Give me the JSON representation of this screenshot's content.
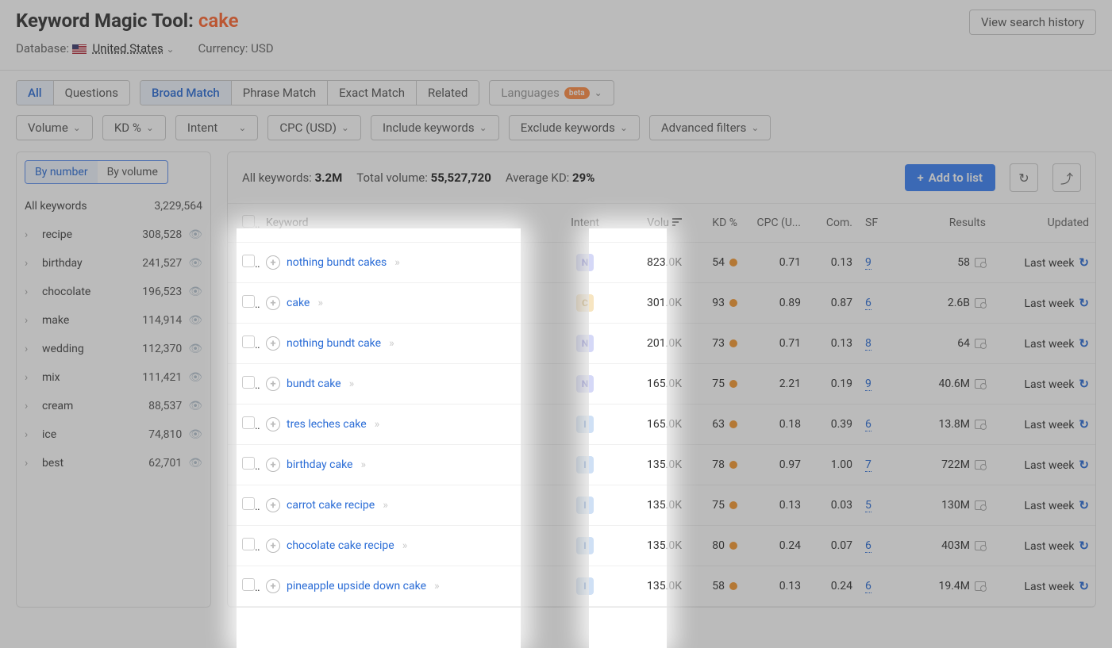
{
  "header": {
    "title_prefix": "Keyword Magic Tool:",
    "title_keyword": "cake",
    "database_label": "Database:",
    "database_value": "United States",
    "currency_label": "Currency:",
    "currency_value": "USD",
    "history_btn": "View search history"
  },
  "tabs_left": {
    "all": "All",
    "questions": "Questions"
  },
  "tabs_match": {
    "broad": "Broad Match",
    "phrase": "Phrase Match",
    "exact": "Exact Match",
    "related": "Related"
  },
  "languages_btn": "Languages",
  "beta_badge": "beta",
  "filters": {
    "volume": "Volume",
    "kd": "KD %",
    "intent": "Intent",
    "cpc": "CPC (USD)",
    "include": "Include keywords",
    "exclude": "Exclude keywords",
    "advanced": "Advanced filters"
  },
  "sidebar": {
    "seg_number": "By number",
    "seg_volume": "By volume",
    "all_label": "All keywords",
    "all_count": "3,229,564",
    "groups": [
      {
        "label": "recipe",
        "count": "308,528"
      },
      {
        "label": "birthday",
        "count": "241,527"
      },
      {
        "label": "chocolate",
        "count": "196,523"
      },
      {
        "label": "make",
        "count": "114,914"
      },
      {
        "label": "wedding",
        "count": "112,370"
      },
      {
        "label": "mix",
        "count": "111,421"
      },
      {
        "label": "cream",
        "count": "88,537"
      },
      {
        "label": "ice",
        "count": "74,810"
      },
      {
        "label": "best",
        "count": "62,701"
      }
    ]
  },
  "stats": {
    "all_kw_label": "All keywords:",
    "all_kw_value": "3.2M",
    "total_vol_label": "Total volume:",
    "total_vol_value": "55,527,720",
    "avg_kd_label": "Average KD:",
    "avg_kd_value": "29%",
    "add_to_list": "Add to list"
  },
  "columns": {
    "keyword": "Keyword",
    "intent": "Intent",
    "volume": "Volu",
    "kd": "KD %",
    "cpc": "CPC (U...",
    "com": "Com.",
    "sf": "SF",
    "results": "Results",
    "updated": "Updated"
  },
  "rows": [
    {
      "kw": "nothing bundt cakes",
      "intent": "N",
      "vol": "823.0K",
      "kd": "54",
      "cpc": "0.71",
      "com": "0.13",
      "sf": "9",
      "results": "58",
      "updated": "Last week"
    },
    {
      "kw": "cake",
      "intent": "C",
      "vol": "301.0K",
      "kd": "93",
      "cpc": "0.89",
      "com": "0.87",
      "sf": "6",
      "results": "2.6B",
      "updated": "Last week"
    },
    {
      "kw": "nothing bundt cake",
      "intent": "N",
      "vol": "201.0K",
      "kd": "73",
      "cpc": "0.71",
      "com": "0.13",
      "sf": "8",
      "results": "64",
      "updated": "Last week"
    },
    {
      "kw": "bundt cake",
      "intent": "N",
      "vol": "165.0K",
      "kd": "75",
      "cpc": "2.21",
      "com": "0.19",
      "sf": "9",
      "results": "40.6M",
      "updated": "Last week"
    },
    {
      "kw": "tres leches cake",
      "intent": "I",
      "vol": "165.0K",
      "kd": "63",
      "cpc": "0.18",
      "com": "0.39",
      "sf": "6",
      "results": "13.8M",
      "updated": "Last week"
    },
    {
      "kw": "birthday cake",
      "intent": "I",
      "vol": "135.0K",
      "kd": "78",
      "cpc": "0.97",
      "com": "1.00",
      "sf": "7",
      "results": "722M",
      "updated": "Last week"
    },
    {
      "kw": "carrot cake recipe",
      "intent": "I",
      "vol": "135.0K",
      "kd": "75",
      "cpc": "0.13",
      "com": "0.03",
      "sf": "5",
      "results": "130M",
      "updated": "Last week"
    },
    {
      "kw": "chocolate cake recipe",
      "intent": "I",
      "vol": "135.0K",
      "kd": "80",
      "cpc": "0.24",
      "com": "0.07",
      "sf": "6",
      "results": "403M",
      "updated": "Last week"
    },
    {
      "kw": "pineapple upside down cake",
      "intent": "I",
      "vol": "135.0K",
      "kd": "58",
      "cpc": "0.13",
      "com": "0.24",
      "sf": "6",
      "results": "19.4M",
      "updated": "Last week"
    }
  ]
}
